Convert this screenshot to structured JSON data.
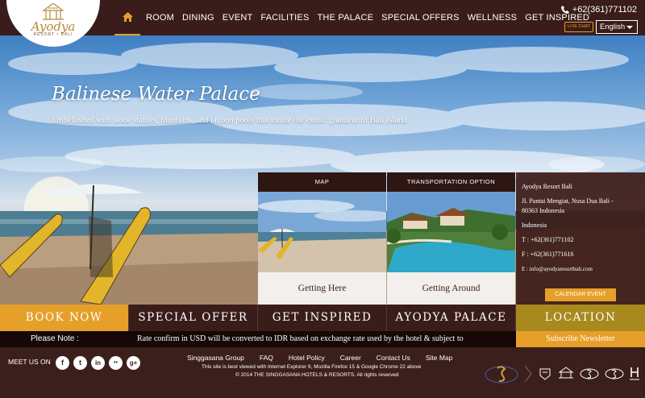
{
  "header": {
    "logo": {
      "name": "Ayodya",
      "tagline": "RESORT • BALI"
    },
    "nav": [
      "ROOM",
      "DINING",
      "EVENT",
      "FACILITIES",
      "THE PALACE",
      "SPECIAL OFFERS",
      "WELLNESS",
      "GET INSPIRED"
    ],
    "phone": "+62(361)771102",
    "live_chat": "LIVE CHAT",
    "language": "English"
  },
  "hero": {
    "title": "Balinese Water Palace",
    "subtitle": "Embellished with stone statues, fountains, and lagoon pools that exude the exotic grandeur of Bali Island"
  },
  "panels": {
    "map": {
      "header": "MAP",
      "footer": "Getting Here"
    },
    "transport": {
      "header": "TRANSPORTATION OPTION",
      "footer": "Getting Around"
    },
    "address": {
      "name": "Ayodya Resort Bali",
      "street": "Jl. Pantai Mengiat, Nusa Dua Bali -",
      "postal": "80363 Indonesia",
      "country": "Indonesia",
      "tel": "T : +62(361)771102",
      "fax": "F : +62(361)771616",
      "email": "E : info@ayodyaresortbali.com",
      "calendar_button": "CALENDAR EVENT"
    }
  },
  "actions": [
    "BOOK NOW",
    "SPECIAL OFFER",
    "GET INSPIRED",
    "AYODYA PALACE",
    "LOCATION"
  ],
  "note": {
    "label": "Please Note :",
    "text": "Rate confirm in USD will be converted to IDR based on exchange rate used by the hotel & subject to"
  },
  "newsletter": "Subscribe Newsletter",
  "footer": {
    "meet_us": "MEET US ON",
    "social": [
      {
        "icon": "facebook-icon",
        "glyph": "f"
      },
      {
        "icon": "twitter-icon",
        "glyph": "t"
      },
      {
        "icon": "linkedin-icon",
        "glyph": "in"
      },
      {
        "icon": "flickr-icon",
        "glyph": "••"
      },
      {
        "icon": "google-plus-icon",
        "glyph": "g+"
      }
    ],
    "links": [
      "Singgasana Group",
      "FAQ",
      "Hotel Policy",
      "Career",
      "Contact Us",
      "Site Map"
    ],
    "browser_note": "This site is best viewed with Internet Explorer 9, Mozilla Firefox 15 & Google Chrome 22 above",
    "copyright": "© 2014 THE SINGGASANA HOTELS & RESORTS. All rights reserved"
  },
  "colors": {
    "accent": "#e6a02a",
    "brown": "#3a1d1a",
    "gold": "#a8891d"
  }
}
